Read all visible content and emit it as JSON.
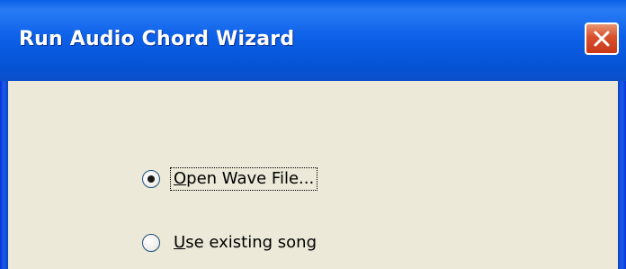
{
  "window": {
    "title": "Run Audio Chord Wizard",
    "close_icon": "close-x-icon"
  },
  "options": [
    {
      "label": "Open Wave File...",
      "mnemonic": "O",
      "rest": "pen Wave File...",
      "selected": true,
      "focused": true
    },
    {
      "label": "Use existing song",
      "mnemonic": "U",
      "rest": "se existing song",
      "selected": false,
      "focused": false
    }
  ],
  "colors": {
    "titlebar": "#0553D6",
    "client_bg": "#ECE9D8",
    "close_button": "#D94F2C"
  }
}
